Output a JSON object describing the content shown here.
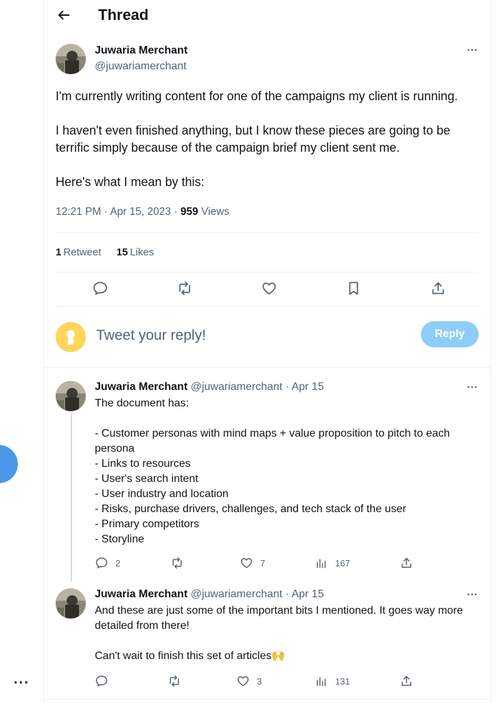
{
  "header": {
    "title": "Thread"
  },
  "main_tweet": {
    "author_name": "Juwaria Merchant",
    "author_handle": "@juwariamerchant",
    "paragraphs": [
      "I'm currently writing content for one of the campaigns my client is running.",
      "I haven't even finished anything, but I know these pieces are going to be terrific simply because of the campaign brief my client sent me.",
      "Here's what I mean by this:"
    ],
    "time": "12:21 PM · Apr 15, 2023 · ",
    "views_count": "959",
    "views_label": " Views",
    "retweets_count": "1",
    "retweets_label": "Retweet",
    "likes_count": "15",
    "likes_label": "Likes"
  },
  "composer": {
    "placeholder": "Tweet your reply!",
    "reply_label": "Reply"
  },
  "replies": [
    {
      "author_name": "Juwaria Merchant",
      "author_handle": "@juwariamerchant",
      "time": " · Apr 15",
      "lines": [
        "The document has:",
        "",
        "- Customer personas with mind maps + value proposition to pitch to each persona",
        "- Links to resources",
        "- User's search intent",
        "- User industry and location",
        "- Risks, purchase drivers, challenges, and tech stack of the user",
        "- Primary competitors",
        "- Storyline"
      ],
      "reply_count": "2",
      "retweet_count": "",
      "like_count": "7",
      "views_count": "167"
    },
    {
      "author_name": "Juwaria Merchant",
      "author_handle": "@juwariamerchant",
      "time": " · Apr 15",
      "lines": [
        "And these are just some of the important bits I mentioned. It goes way more detailed from there!",
        "",
        "Can't wait to finish this set of articles🙌"
      ],
      "reply_count": "",
      "retweet_count": "",
      "like_count": "3",
      "views_count": "131"
    }
  ],
  "colors": {
    "text": "#0f1419",
    "secondary": "#536471",
    "reply_button": "#8ecdf8",
    "default_avatar": "#ffd659",
    "blue_fab": "#4a99e9"
  },
  "icons": [
    "back-arrow-icon",
    "more-icon",
    "reply-icon",
    "retweet-icon",
    "like-icon",
    "bookmark-icon",
    "share-icon",
    "views-icon",
    "keyhole-icon"
  ]
}
